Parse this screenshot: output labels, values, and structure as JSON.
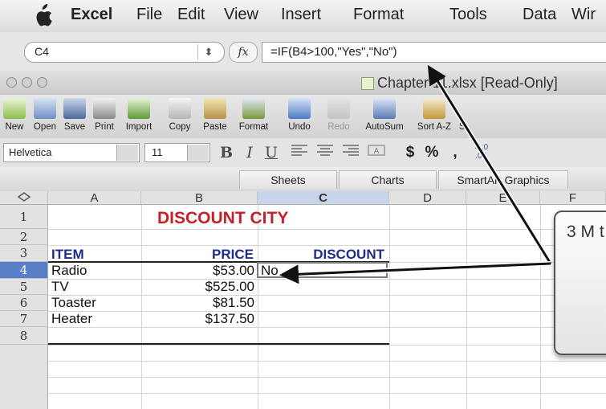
{
  "menubar": {
    "items": [
      "Excel",
      "File",
      "Edit",
      "View",
      "Insert",
      "Format",
      "Tools",
      "Data",
      "Wir"
    ]
  },
  "formula_bar": {
    "name_box": "C4",
    "stepper": "⬍",
    "fx": "fx",
    "formula": "=IF(B4>100,\"Yes\",\"No\")"
  },
  "window": {
    "title": "Chapter 11.xlsx  [Read-Only]"
  },
  "toolbar": {
    "buttons": [
      "New",
      "Open",
      "Save",
      "Print",
      "Import",
      "Copy",
      "Paste",
      "Format",
      "Undo",
      "Redo",
      "AutoSum",
      "Sort A-Z",
      "S"
    ],
    "icons": [
      "new-workbook-icon",
      "open-icon",
      "save-icon",
      "print-icon",
      "import-icon",
      "copy-icon",
      "paste-icon",
      "format-painter-icon",
      "undo-icon",
      "redo-icon",
      "autosum-icon",
      "sort-az-icon"
    ]
  },
  "formatting": {
    "font_name": "Helvetica",
    "font_size": "11",
    "bold": "B",
    "italic": "I",
    "underline": "U",
    "currency": "$",
    "percent": "%",
    "comma": ",",
    "increase_decimal": "←.0\n.00"
  },
  "ribbon": {
    "tabs": [
      "Sheets",
      "Charts",
      "SmartArt Graphics"
    ]
  },
  "sheet": {
    "columns": [
      "A",
      "B",
      "C",
      "D",
      "E",
      "F"
    ],
    "rows": [
      "1",
      "2",
      "3",
      "4",
      "5",
      "6",
      "7",
      "8"
    ],
    "selected_cell": "C4",
    "cells": {
      "b1": "DISCOUNT CITY",
      "a3": "ITEM",
      "b3": "PRICE",
      "c3": "DISCOUNT",
      "a4": "Radio",
      "b4": "$53.00",
      "c4": "No",
      "a5": "TV",
      "b5": "$525.00",
      "a6": "Toaster",
      "b6": "$81.50",
      "a7": "Heater",
      "b7": "$137.50"
    }
  },
  "callout": {
    "text": "3  M t"
  },
  "colors": {
    "heading_red": "#c8202a",
    "heading_navy": "#1f2d8a",
    "selection_blue": "#5a7ec8"
  }
}
